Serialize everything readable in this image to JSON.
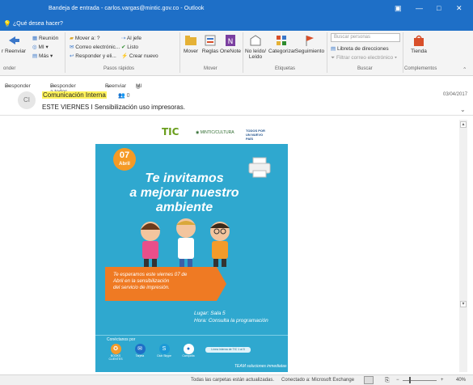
{
  "window": {
    "title": "Bandeja de entrada - carlos.vargas@mintic.gov.co - Outlook",
    "controls": [
      "▣",
      "—",
      "□",
      "✕"
    ]
  },
  "tellme": {
    "text": "¿Qué desea hacer?"
  },
  "ribbon": {
    "respond": {
      "reply_label": "r Reenviar",
      "meeting": "Reunión",
      "im": "MI ▾",
      "more": "Más ▾",
      "group": "onder"
    },
    "quicksteps": {
      "items": [
        "Mover a: ?",
        "Correo electrónic...",
        "Responder y eli...",
        "Al jefe",
        "Listo",
        "Crear nuevo"
      ],
      "group": "Pasos rápidos"
    },
    "move": {
      "mover": "Mover",
      "reglas": "Reglas",
      "onenote": "OneNote",
      "group": "Mover"
    },
    "tags": {
      "unread": "No leído/ Leído",
      "categorize": "Categorizar",
      "followup": "Seguimiento",
      "group": "Etiquetas"
    },
    "find": {
      "search_placeholder": "Buscar personas",
      "address_book": "Libreta de direcciones",
      "filter": "Filtrar correo electrónico ▾",
      "group": "Buscar"
    },
    "addins": {
      "store": "Tienda",
      "group": "Complementos"
    },
    "collapse": "⌃"
  },
  "actions": {
    "reply": "Responder",
    "reply_all": "Responder a todos",
    "forward": "Reenviar",
    "im": "MI"
  },
  "message": {
    "avatar": "CI",
    "sender": "Comunicación Interna",
    "people_icon": "👥",
    "people_count": "0",
    "subject": "ESTE VIERNES I Sensibilización uso impresoras.",
    "date": "03/04/2017"
  },
  "poster": {
    "tic": "TIC",
    "mintic": "◉ MINTIC/CULTURA",
    "gov": "TODOS POR UN NUEVO PAÍS",
    "day": "07",
    "month": "Abril",
    "headline_1": "Te invitamos",
    "headline_2": "a mejorar nuestro",
    "headline_3": "ambiente",
    "banner_1": "Te esperamos este viernes 07 de",
    "banner_2": "Abril en la sensibilización",
    "banner_3": "del servicio de impresión.",
    "lugar": "Lugar: Sala 5",
    "hora": "Hora: Consulta la programación",
    "connect": "Conéctanos por",
    "icons": [
      {
        "glyph": "✪",
        "label": "BOOKS CLIENTES"
      },
      {
        "glyph": "✉",
        "label": "Tarjeta"
      },
      {
        "glyph": "S",
        "label": "Club Skype"
      },
      {
        "glyph": "●",
        "label": "Campaña"
      }
    ],
    "pill": "Línea interna de TIC 1 al 5",
    "team": "TEAM soluciones inmediatas"
  },
  "status": {
    "folders": "Todas las carpetas están actualizadas.",
    "connection": "Conectado a: Microsoft Exchange",
    "zoom": "40%",
    "zoom_minus": "−",
    "zoom_plus": "+"
  },
  "colors": {
    "titlebar": "#1e6fc7",
    "poster_bg": "#2fa8cf",
    "orange": "#ef7a23",
    "highlight": "#fff35a"
  }
}
